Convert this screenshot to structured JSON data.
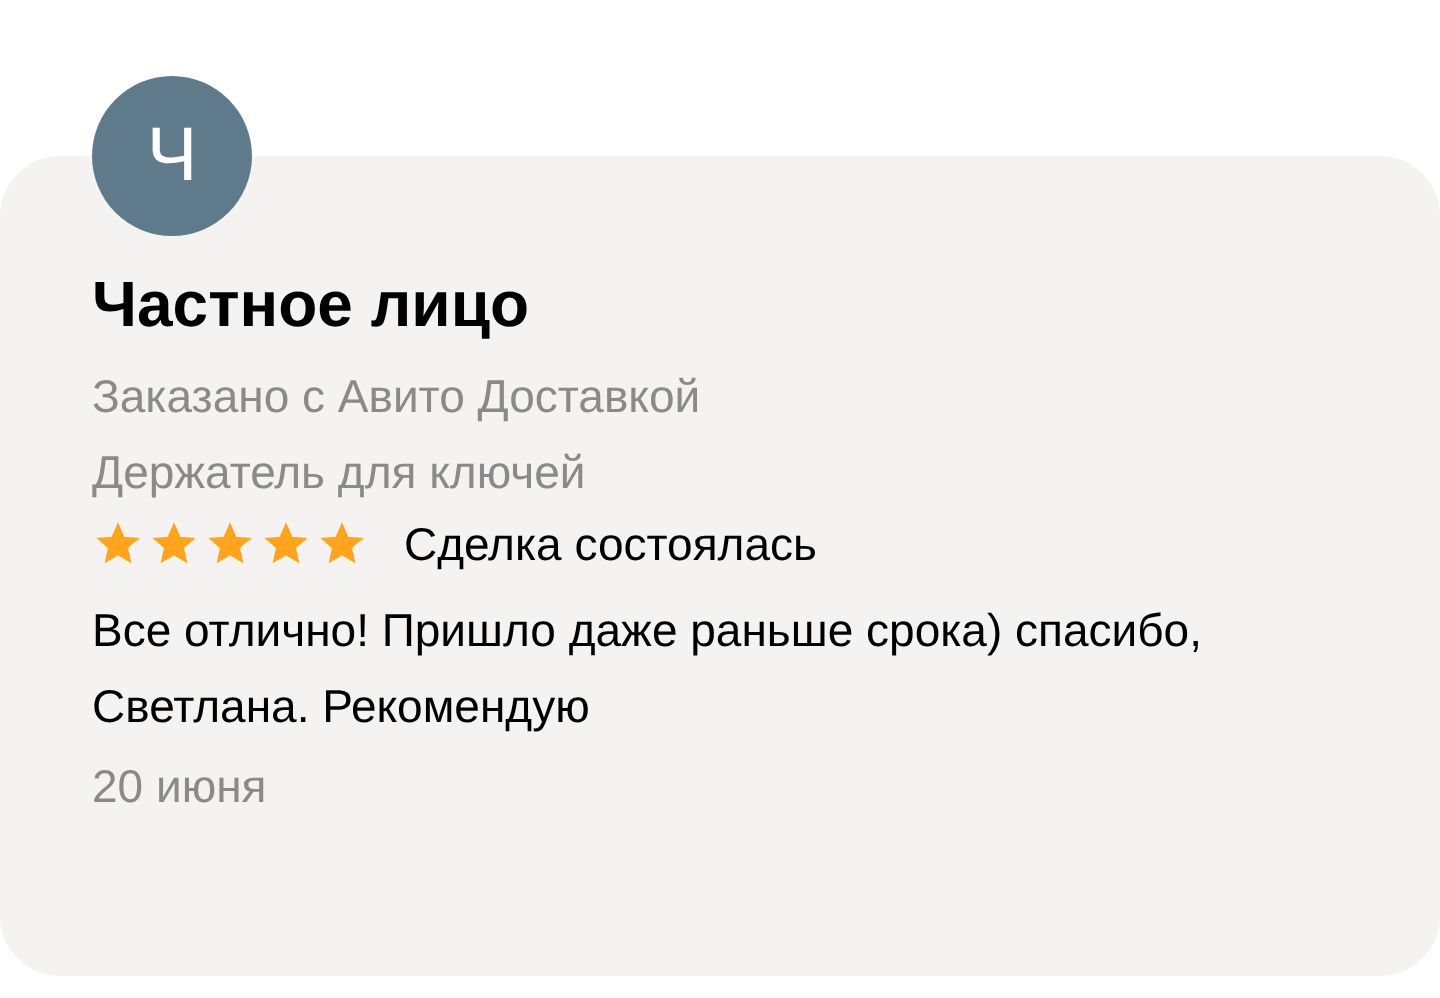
{
  "review": {
    "avatar_letter": "Ч",
    "author": "Частное лицо",
    "order_info": "Заказано с Авито Доставкой",
    "item": "Держатель для ключей",
    "stars": 5,
    "deal_status": "Сделка состоялась",
    "text": "Все отлично! Пришло даже раньше срока) спасибо, Светлана. Рекомендую",
    "date": "20 июня"
  }
}
